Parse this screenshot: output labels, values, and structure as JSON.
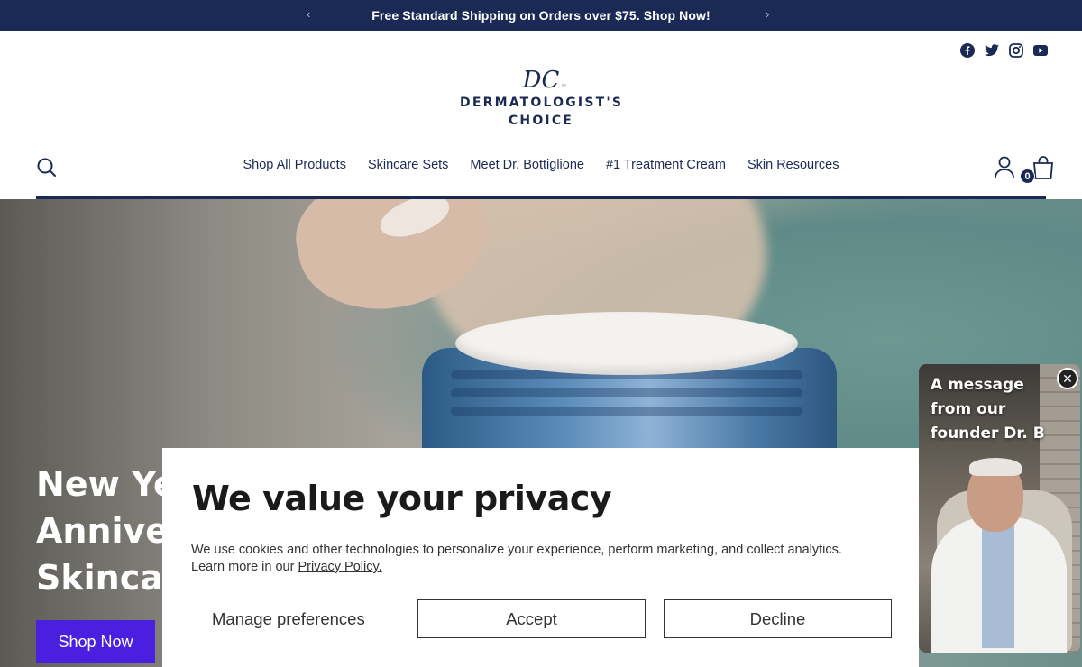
{
  "announcement": {
    "text": "Free Standard Shipping on Orders over $75. Shop Now!",
    "prev_glyph": "‹",
    "next_glyph": "›"
  },
  "social": [
    "facebook-icon",
    "twitter-icon",
    "instagram-icon",
    "youtube-icon"
  ],
  "logo": {
    "monogram": "DC",
    "trademark": "™",
    "line1": "DERMATOLOGIST'S",
    "line2": "CHOICE"
  },
  "nav": {
    "items": [
      "Shop All Products",
      "Skincare Sets",
      "Meet Dr. Bottiglione",
      "#1 Treatment Cream",
      "Skin Resources"
    ],
    "cart_count": "0"
  },
  "hero": {
    "headline_line1": "New Ye",
    "headline_line2": "Annive",
    "headline_line3": "Skinca",
    "cta": "Shop Now"
  },
  "privacy": {
    "title": "We value your privacy",
    "description": "We use cookies and other technologies to personalize your experience, perform marketing, and collect analytics. Learn more in our",
    "policy_link": "Privacy Policy.",
    "manage": "Manage preferences",
    "accept": "Accept",
    "decline": "Decline"
  },
  "video": {
    "line1": "A message",
    "line2": "from our",
    "line3": "founder Dr. B",
    "close_glyph": "✕"
  },
  "colors": {
    "navy": "#1b2a55",
    "cta_purple": "#4a1fe0"
  }
}
